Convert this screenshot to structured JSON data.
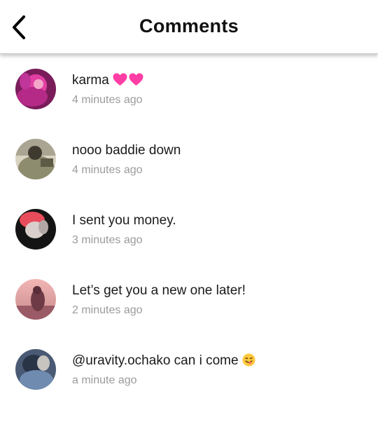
{
  "header": {
    "title": "Comments",
    "back_icon": "chevron-left-icon"
  },
  "comments": [
    {
      "text": "karma",
      "emoji_icon": "pink-heart-icon",
      "emoji_count": 2,
      "time": "4 minutes ago",
      "avatar_colors": [
        "#e23fa3",
        "#7a1c5a"
      ]
    },
    {
      "text": "nooo baddie down",
      "time": "4 minutes ago",
      "avatar_colors": [
        "#8d8c6e",
        "#3f3a30"
      ]
    },
    {
      "text": "I sent you money.",
      "time": "3 minutes ago",
      "avatar_colors": [
        "#e84c5a",
        "#141414"
      ]
    },
    {
      "text": "Let’s get you a new one later!",
      "time": "2 minutes ago",
      "avatar_colors": [
        "#c98a8e",
        "#6e3a46"
      ]
    },
    {
      "text": "@uravity.ochako can i come",
      "emoji_icon": "savoring-face-icon",
      "emoji_count": 1,
      "time": "a minute ago",
      "avatar_colors": [
        "#6f8bb0",
        "#2a3447"
      ]
    }
  ],
  "colors": {
    "heart": "#ff3ea5",
    "emoji_face": "#ffc83d",
    "timestamp": "#9b9b9b"
  }
}
